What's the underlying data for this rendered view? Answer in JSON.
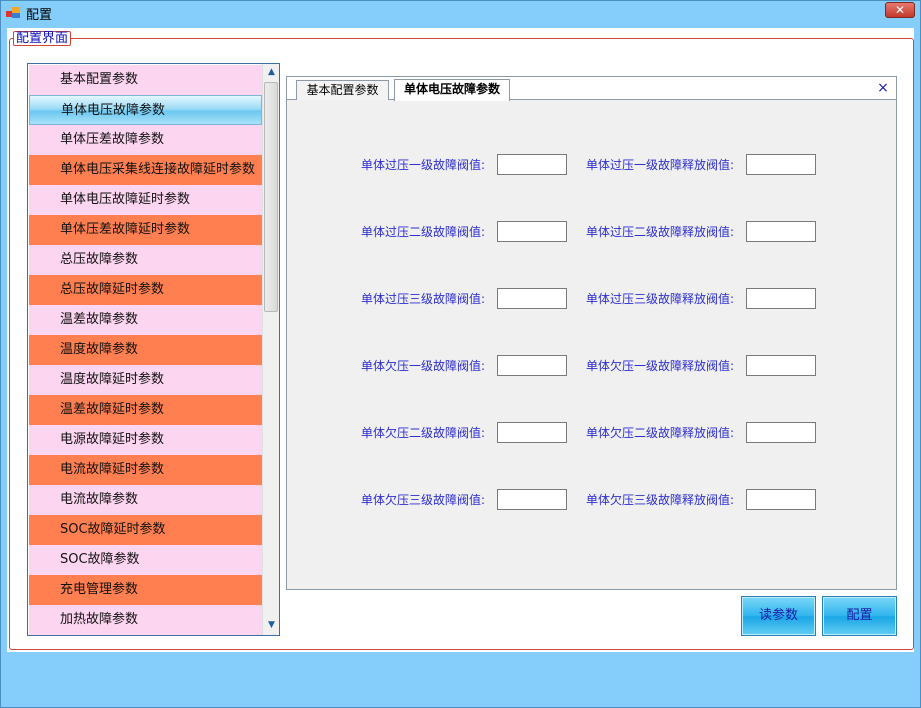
{
  "window": {
    "title": "配置"
  },
  "group": {
    "title": "配置界面"
  },
  "list": {
    "items": [
      {
        "label": "基本配置参数",
        "style": "pink"
      },
      {
        "label": "单体电压故障参数",
        "style": "selected"
      },
      {
        "label": "单体压差故障参数",
        "style": "pink"
      },
      {
        "label": "单体电压采集线连接故障延时参数",
        "style": "orange"
      },
      {
        "label": "单体电压故障延时参数",
        "style": "pink"
      },
      {
        "label": "单体压差故障延时参数",
        "style": "orange"
      },
      {
        "label": "总压故障参数",
        "style": "pink"
      },
      {
        "label": "总压故障延时参数",
        "style": "orange"
      },
      {
        "label": "温差故障参数",
        "style": "pink"
      },
      {
        "label": "温度故障参数",
        "style": "orange"
      },
      {
        "label": "温度故障延时参数",
        "style": "pink"
      },
      {
        "label": "温差故障延时参数",
        "style": "orange"
      },
      {
        "label": "电源故障延时参数",
        "style": "pink"
      },
      {
        "label": "电流故障延时参数",
        "style": "orange"
      },
      {
        "label": "电流故障参数",
        "style": "pink"
      },
      {
        "label": "SOC故障延时参数",
        "style": "orange"
      },
      {
        "label": "SOC故障参数",
        "style": "pink"
      },
      {
        "label": "充电管理参数",
        "style": "orange"
      },
      {
        "label": "加热故障参数",
        "style": "pink"
      }
    ]
  },
  "tabs": [
    {
      "label": "基本配置参数",
      "active": false
    },
    {
      "label": "单体电压故障参数",
      "active": true
    }
  ],
  "tab_close_glyph": "×",
  "form": {
    "rows": [
      {
        "left_label": "单体过压一级故障阀值:",
        "left_value": "",
        "right_label": "单体过压一级故障释放阀值:",
        "right_value": ""
      },
      {
        "left_label": "单体过压二级故障阀值:",
        "left_value": "",
        "right_label": "单体过压二级故障释放阀值:",
        "right_value": ""
      },
      {
        "left_label": "单体过压三级故障阀值:",
        "left_value": "",
        "right_label": "单体过压三级故障释放阀值:",
        "right_value": ""
      },
      {
        "left_label": "单体欠压一级故障阀值:",
        "left_value": "",
        "right_label": "单体欠压一级故障释放阀值:",
        "right_value": ""
      },
      {
        "left_label": "单体欠压二级故障阀值:",
        "left_value": "",
        "right_label": "单体欠压二级故障释放阀值:",
        "right_value": ""
      },
      {
        "left_label": "单体欠压三级故障阀值:",
        "left_value": "",
        "right_label": "单体欠压三级故障释放阀值:",
        "right_value": ""
      }
    ]
  },
  "buttons": {
    "read_label": "读参数",
    "config_label": "配置"
  },
  "colors": {
    "window_bg": "#85cdfb",
    "list_pink": "#fcd5f0",
    "list_orange": "#ff7f50",
    "label_blue": "#2d2dd0",
    "group_border": "#d0453a"
  },
  "icons": {
    "app": "app-icon",
    "close": "close-icon",
    "scroll_up": "scroll-up-icon",
    "scroll_down": "scroll-down-icon",
    "tab_close": "tab-close-icon"
  }
}
